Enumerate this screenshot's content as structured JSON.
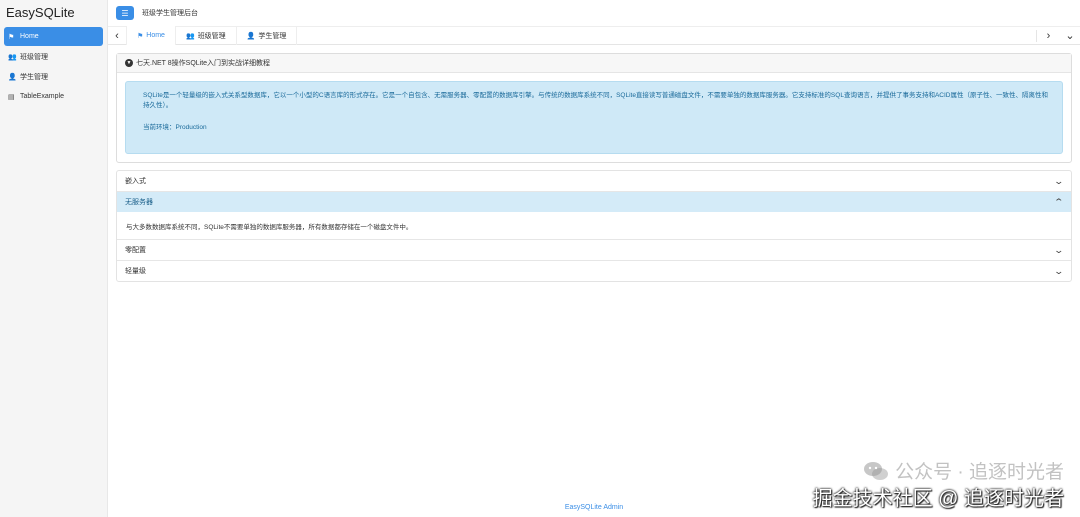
{
  "app": {
    "brand": "EasySQLite",
    "header_title": "班级学生管理后台"
  },
  "sidebar": {
    "items": [
      {
        "label": "Home",
        "icon": "flag-icon",
        "active": true
      },
      {
        "label": "班级管理",
        "icon": "users-icon",
        "active": false
      },
      {
        "label": "学生管理",
        "icon": "user-icon",
        "active": false
      },
      {
        "label": "TableExample",
        "icon": "table-icon",
        "active": false
      }
    ]
  },
  "tabs": [
    {
      "label": "Home",
      "icon": "flag-icon",
      "active": true
    },
    {
      "label": "班级管理",
      "icon": "users-icon",
      "active": false
    },
    {
      "label": "学生管理",
      "icon": "user-icon",
      "active": false
    }
  ],
  "card": {
    "title": "七天.NET 8操作SQLite入门到实战详细教程",
    "alert_text": "SQLite是一个轻量级的嵌入式关系型数据库，它以一个小型的C语言库的形式存在。它是一个自包含、无需服务器、零配置的数据库引擎。与传统的数据库系统不同，SQLite直接读写普通磁盘文件，不需要单独的数据库服务器。它支持标准的SQL查询语言，并提供了事务支持和ACID属性（原子性、一致性、隔离性和持久性）。",
    "env_text": "当前环境：Production"
  },
  "accordion": [
    {
      "title": "嵌入式",
      "open": false,
      "body": ""
    },
    {
      "title": "无服务器",
      "open": true,
      "body": "与大多数数据库系统不同，SQLite不需要单独的数据库服务器，所有数据都存储在一个磁盘文件中。"
    },
    {
      "title": "零配置",
      "open": false,
      "body": ""
    },
    {
      "title": "轻量级",
      "open": false,
      "body": ""
    }
  ],
  "footer": {
    "text": "EasySQLite Admin"
  },
  "watermark": {
    "line1": "公众号 · 追逐时光者",
    "line2": "掘金技术社区 @ 追逐时光者"
  },
  "colors": {
    "accent": "#3a8ee6",
    "alert_bg": "#cfe9f7",
    "alert_text": "#1a6a9a"
  }
}
